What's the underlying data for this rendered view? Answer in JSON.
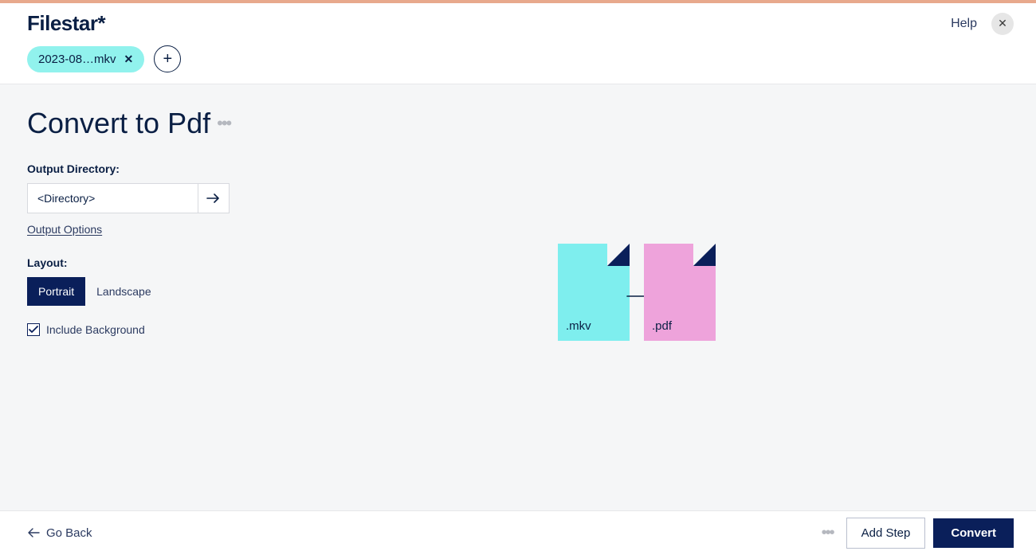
{
  "header": {
    "logo": "Filestar*",
    "help": "Help"
  },
  "chips": {
    "file_name": "2023-08…mkv"
  },
  "page": {
    "title": "Convert to Pdf"
  },
  "output": {
    "label": "Output Directory:",
    "value": "<Directory>",
    "options_link": "Output Options"
  },
  "layout": {
    "label": "Layout:",
    "portrait": "Portrait",
    "landscape": "Landscape"
  },
  "include_bg": {
    "label": "Include Background"
  },
  "preview": {
    "src_ext": ".mkv",
    "dst_ext": ".pdf"
  },
  "footer": {
    "back": "Go Back",
    "add_step": "Add Step",
    "convert": "Convert"
  }
}
